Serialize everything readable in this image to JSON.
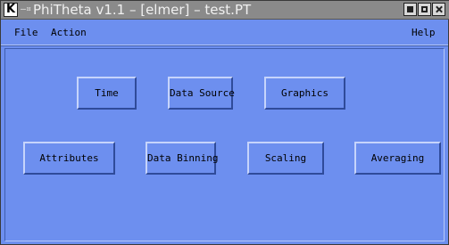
{
  "window": {
    "title": "PhiTheta v1.1 – [elmer] – test.PT",
    "app_icon_glyph": "K",
    "menu_glyph": "–¤"
  },
  "menubar": {
    "file_label": "File",
    "action_label": "Action",
    "help_label": "Help"
  },
  "buttons": {
    "time": "Time",
    "data_source": "Data Source",
    "graphics": "Graphics",
    "attributes": "Attributes",
    "data_binning": "Data Binning",
    "scaling": "Scaling",
    "averaging": "Averaging"
  },
  "colors": {
    "background": "#6d8fef",
    "titlebar": "#8a8a8a"
  }
}
